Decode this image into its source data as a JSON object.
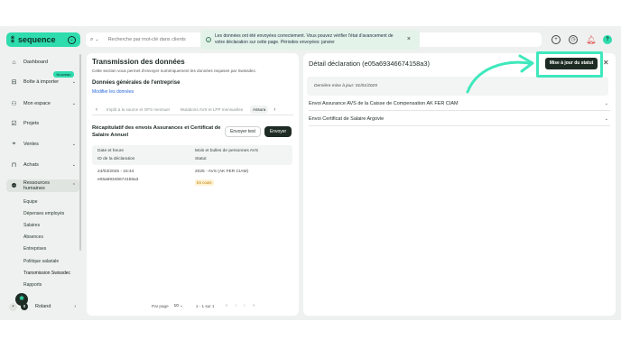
{
  "brand": {
    "name": "sequence",
    "mark": "⁑"
  },
  "search": {
    "placeholder": "Recherche par mot-clé dans clients"
  },
  "toast": {
    "message": "Les données ont été envoyées correctement. Vous pouvez vérifier l'état d'avancement de votre déclaration sur cette page. Périodes envoyées: janvier"
  },
  "topbar": {
    "notification_color": "#e04a4a",
    "accent": "#2fdcae"
  },
  "sidebar": {
    "items": [
      {
        "label": "Dashboard",
        "icon": "home-icon"
      },
      {
        "label": "Boîte à importer",
        "icon": "inbox-icon"
      },
      {
        "label": "Mon espace",
        "icon": "person-icon"
      },
      {
        "label": "Projets",
        "icon": "check-square-icon"
      },
      {
        "label": "Ventes",
        "icon": "tag-icon"
      },
      {
        "label": "Achats",
        "icon": "bag-icon"
      },
      {
        "label": "Ressources humaines",
        "icon": "people-icon"
      }
    ],
    "new_badge": "Nouveau",
    "subitems": [
      "Equipe",
      "Dépenses employés",
      "Salaires",
      "Absences",
      "Entreprises",
      "Politique salariale",
      "Transmission Swissdec",
      "Rapports"
    ],
    "user": {
      "name": "Roland",
      "notifications": "8"
    }
  },
  "main": {
    "title": "Transmission des données",
    "description": "Cette section vous permet d'envoyer numériquement les données requises par Swissdec.",
    "section_title": "Données générales de l'entreprise",
    "edit_link": "Modifier les données",
    "tabs": [
      "Impôt à la source et OFS mensuel",
      "Mutations AVS et LPP mensuelles",
      "Assura"
    ],
    "summary_title": "Récapitulatif des envois Assurances et Certificat de Salaire Annuel",
    "btn_test": "Envoyer test",
    "btn_send": "Envoyer",
    "table": {
      "headers": [
        "Date et heure",
        "Mois et bulles de personnes AVS",
        "ID de la déclaration",
        "Statut"
      ],
      "rows": [
        {
          "date": "24/03/2025 - 16:44",
          "id": "e05a69346674158a3",
          "period": "2025 - AVS (AK FER CIAM)",
          "status": "En cours"
        }
      ]
    },
    "pager": {
      "label": "Par page",
      "per_page": "10",
      "range": "1 - 1 sur 1"
    }
  },
  "detail": {
    "title": "Détail déclaration (e05a69346674158a3)",
    "update_button": "Mise à jour du statut",
    "last_update": "Dernière mise à jour: 01/01/2025",
    "accordions": [
      "Envoi Assurance AVS de la Caisse de Compensation AK FER CIAM",
      "Envoi Certificat de Salaire Argovie"
    ],
    "highlight_color": "#3fe8bd"
  }
}
